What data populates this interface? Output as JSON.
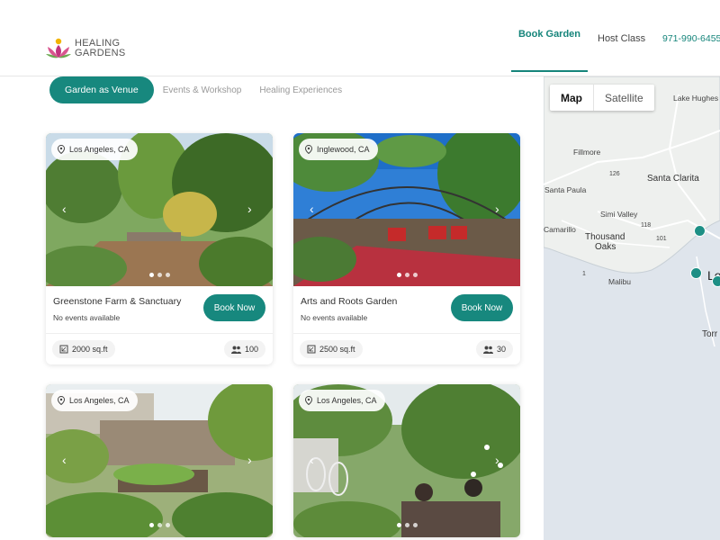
{
  "brand": {
    "name_line1": "HEALING",
    "name_line2": "GARDENS"
  },
  "nav": {
    "book_garden": "Book Garden",
    "host_class": "Host Class",
    "phone": "971-990-6455"
  },
  "tabs": [
    {
      "label": "Garden as Venue",
      "active": true
    },
    {
      "label": "Events & Workshop",
      "active": false
    },
    {
      "label": "Healing Experiences",
      "active": false
    }
  ],
  "cards": [
    {
      "location": "Los Angeles, CA",
      "name": "Greenstone Farm & Sanctuary",
      "events": "No events available",
      "area": "2000 sq.ft",
      "capacity": "100",
      "book_label": "Book Now"
    },
    {
      "location": "Inglewood, CA",
      "name": "Arts and Roots Garden",
      "events": "No events available",
      "area": "2500 sq.ft",
      "capacity": "30",
      "book_label": "Book Now"
    },
    {
      "location": "Los Angeles, CA"
    },
    {
      "location": "Los Angeles, CA"
    }
  ],
  "map": {
    "toggle_map": "Map",
    "toggle_satellite": "Satellite",
    "places": [
      "Lake Hughes",
      "Fillmore",
      "Santa Clarita",
      "Santa Paula",
      "Simi Valley",
      "Camarillo",
      "Thousand",
      "Oaks",
      "Malibu",
      "Torr",
      "Lo"
    ],
    "route_numbers": [
      "126",
      "118",
      "101",
      "1"
    ]
  },
  "colors": {
    "accent": "#17887e"
  }
}
